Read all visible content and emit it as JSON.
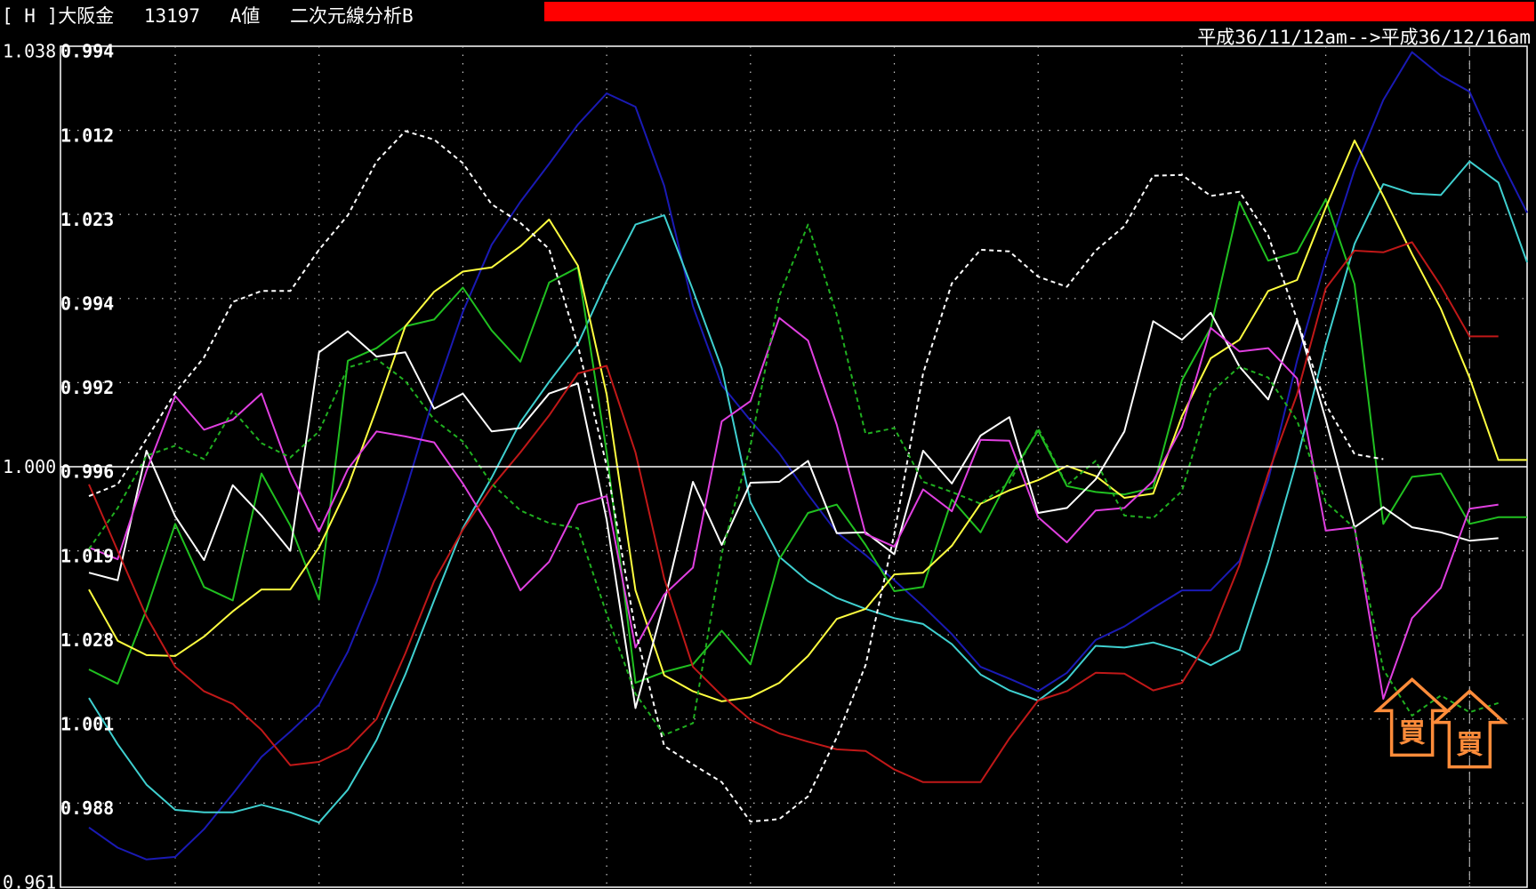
{
  "header": {
    "title": "[ H ]大阪金　 13197　 A値　 二次元線分析B",
    "date_range": "平成36/11/12am-->平成36/12/16am",
    "accent_bar_color": "#ff0000"
  },
  "chart_data": {
    "type": "line",
    "y_outer_labels": [
      "1.038",
      "1.000",
      "0.961"
    ],
    "y_inner_labels": [
      "0.994",
      "1.012",
      "1.023",
      "0.994",
      "0.992",
      "0.996",
      "1.019",
      "1.028",
      "1.001",
      "0.988"
    ],
    "ylim": [
      0,
      1
    ],
    "zero_line": 0.5,
    "grid": true,
    "x_count": 50,
    "signals": [
      {
        "label": "買",
        "index": 46,
        "color": "#ff8c3a",
        "level": 0.217
      },
      {
        "label": "買",
        "index": 48,
        "color": "#ff8c3a",
        "level": 0.203
      }
    ],
    "series": [
      {
        "color": "#1a1ab4",
        "style": "solid",
        "values": [
          0.071,
          0.047,
          0.033,
          0.036,
          0.069,
          0.111,
          0.155,
          0.185,
          0.217,
          0.28,
          0.363,
          0.47,
          0.584,
          0.684,
          0.764,
          0.815,
          0.86,
          0.907,
          0.944,
          0.928,
          0.834,
          0.691,
          0.597,
          0.555,
          0.516,
          0.467,
          0.422,
          0.395,
          0.365,
          0.334,
          0.301,
          0.262,
          0.248,
          0.233,
          0.255,
          0.294,
          0.31,
          0.332,
          0.353,
          0.353,
          0.388,
          0.484,
          0.626,
          0.746,
          0.853,
          0.936,
          0.993,
          0.965,
          0.946,
          0.87,
          0.802
        ]
      },
      {
        "color": "#3fd0d0",
        "style": "solid",
        "values": [
          0.225,
          0.17,
          0.122,
          0.092,
          0.089,
          0.089,
          0.098,
          0.089,
          0.077,
          0.116,
          0.175,
          0.253,
          0.341,
          0.427,
          0.487,
          0.553,
          0.601,
          0.646,
          0.721,
          0.788,
          0.799,
          0.71,
          0.617,
          0.458,
          0.393,
          0.364,
          0.344,
          0.331,
          0.32,
          0.313,
          0.289,
          0.253,
          0.234,
          0.222,
          0.247,
          0.287,
          0.285,
          0.291,
          0.281,
          0.264,
          0.282,
          0.387,
          0.508,
          0.645,
          0.765,
          0.836,
          0.825,
          0.823,
          0.863,
          0.838,
          0.743
        ]
      },
      {
        "color": "#20c020",
        "style": "solid",
        "values": [
          0.259,
          0.242,
          0.33,
          0.432,
          0.357,
          0.341,
          0.492,
          0.43,
          0.342,
          0.626,
          0.641,
          0.667,
          0.675,
          0.713,
          0.662,
          0.625,
          0.719,
          0.737,
          0.517,
          0.243,
          0.256,
          0.265,
          0.305,
          0.265,
          0.39,
          0.445,
          0.455,
          0.407,
          0.352,
          0.357,
          0.461,
          0.422,
          0.487,
          0.543,
          0.477,
          0.47,
          0.467,
          0.475,
          0.603,
          0.665,
          0.815,
          0.745,
          0.755,
          0.818,
          0.717,
          0.432,
          0.488,
          0.492,
          0.432,
          0.44,
          0.44
        ]
      },
      {
        "color": "#ffff40",
        "style": "solid",
        "values": [
          0.354,
          0.293,
          0.276,
          0.275,
          0.298,
          0.328,
          0.354,
          0.354,
          0.404,
          0.476,
          0.569,
          0.667,
          0.708,
          0.732,
          0.737,
          0.762,
          0.794,
          0.739,
          0.586,
          0.353,
          0.252,
          0.233,
          0.221,
          0.226,
          0.243,
          0.275,
          0.319,
          0.331,
          0.372,
          0.374,
          0.406,
          0.456,
          0.472,
          0.484,
          0.501,
          0.489,
          0.463,
          0.468,
          0.56,
          0.629,
          0.651,
          0.709,
          0.722,
          0.808,
          0.888,
          0.822,
          0.753,
          0.688,
          0.606,
          0.508,
          0.508
        ]
      },
      {
        "color": "#ffffff",
        "style": "solid",
        "values": [
          0.374,
          0.365,
          0.519,
          0.441,
          0.389,
          0.478,
          0.442,
          0.4,
          0.636,
          0.661,
          0.631,
          0.636,
          0.569,
          0.587,
          0.542,
          0.546,
          0.587,
          0.599,
          0.437,
          0.213,
          0.339,
          0.482,
          0.407,
          0.481,
          0.482,
          0.507,
          0.421,
          0.422,
          0.396,
          0.519,
          0.48,
          0.537,
          0.559,
          0.445,
          0.451,
          0.485,
          0.542,
          0.673,
          0.651,
          0.683,
          0.619,
          0.58,
          0.674,
          0.556,
          0.428,
          0.452,
          0.428,
          0.422,
          0.412,
          0.415
        ]
      },
      {
        "color": "#e040e0",
        "style": "solid",
        "values": [
          0.404,
          0.39,
          0.495,
          0.584,
          0.544,
          0.556,
          0.587,
          0.493,
          0.423,
          0.497,
          0.542,
          0.536,
          0.529,
          0.48,
          0.424,
          0.353,
          0.387,
          0.455,
          0.465,
          0.285,
          0.348,
          0.38,
          0.554,
          0.578,
          0.677,
          0.65,
          0.55,
          0.42,
          0.405,
          0.473,
          0.447,
          0.532,
          0.531,
          0.44,
          0.41,
          0.448,
          0.451,
          0.483,
          0.547,
          0.665,
          0.637,
          0.641,
          0.605,
          0.424,
          0.428,
          0.224,
          0.32,
          0.356,
          0.45,
          0.455
        ]
      },
      {
        "color": "#c01818",
        "style": "solid",
        "values": [
          0.479,
          0.4,
          0.322,
          0.262,
          0.233,
          0.218,
          0.187,
          0.145,
          0.149,
          0.165,
          0.2,
          0.278,
          0.364,
          0.425,
          0.476,
          0.517,
          0.561,
          0.611,
          0.62,
          0.517,
          0.367,
          0.262,
          0.228,
          0.199,
          0.183,
          0.173,
          0.164,
          0.162,
          0.14,
          0.125,
          0.125,
          0.125,
          0.177,
          0.222,
          0.233,
          0.255,
          0.254,
          0.234,
          0.243,
          0.298,
          0.383,
          0.492,
          0.586,
          0.712,
          0.757,
          0.755,
          0.767,
          0.715,
          0.655,
          0.655
        ]
      },
      {
        "color": "#ffffff",
        "style": "dashed",
        "values": [
          0.465,
          0.479,
          0.533,
          0.588,
          0.63,
          0.696,
          0.709,
          0.709,
          0.758,
          0.799,
          0.863,
          0.899,
          0.889,
          0.861,
          0.812,
          0.79,
          0.759,
          0.644,
          0.501,
          0.305,
          0.168,
          0.146,
          0.125,
          0.078,
          0.081,
          0.108,
          0.178,
          0.264,
          0.42,
          0.611,
          0.718,
          0.758,
          0.756,
          0.726,
          0.714,
          0.757,
          0.786,
          0.846,
          0.847,
          0.822,
          0.827,
          0.775,
          0.675,
          0.574,
          0.515,
          0.509
        ]
      },
      {
        "color": "#20b020",
        "style": "dashed",
        "values": [
          0.402,
          0.451,
          0.513,
          0.525,
          0.509,
          0.567,
          0.528,
          0.511,
          0.542,
          0.618,
          0.628,
          0.602,
          0.556,
          0.53,
          0.48,
          0.448,
          0.433,
          0.427,
          0.325,
          0.23,
          0.181,
          0.195,
          0.397,
          0.525,
          0.703,
          0.788,
          0.681,
          0.539,
          0.546,
          0.482,
          0.47,
          0.456,
          0.481,
          0.546,
          0.478,
          0.507,
          0.442,
          0.439,
          0.471,
          0.588,
          0.619,
          0.606,
          0.555,
          0.458,
          0.427,
          0.259,
          0.204,
          0.228,
          0.208,
          0.219
        ]
      }
    ]
  }
}
